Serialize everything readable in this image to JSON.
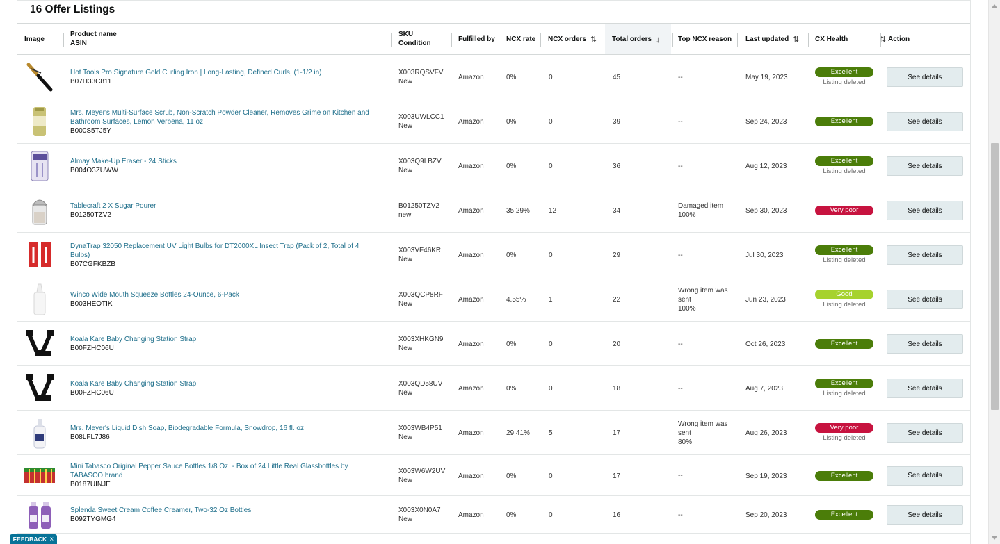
{
  "title": "16 Offer Listings",
  "headers": {
    "image": "Image",
    "product_name": "Product name",
    "asin": "ASIN",
    "sku": "SKU",
    "condition": "Condition",
    "fulfilled_by": "Fulfilled by",
    "ncx_rate": "NCX rate",
    "ncx_orders": "NCX orders",
    "total_orders": "Total orders",
    "top_ncx_reason": "Top NCX reason",
    "last_updated": "Last updated",
    "cx_health": "CX Health",
    "action": "Action"
  },
  "icons": {
    "sort_both": "sort-both-icon",
    "sort_down": "sort-down-icon",
    "close": "close-icon"
  },
  "colors": {
    "excellent": "#4b7d09",
    "good": "#a6d22e",
    "very_poor": "#c7133f",
    "link": "#1f6f8b",
    "feedback": "#077398"
  },
  "rows": [
    {
      "name": "Hot Tools Pro Signature Gold Curling Iron | Long-Lasting, Defined Curls, (1-1/2 in)",
      "asin": "B07H33C811",
      "sku": "X003RQSVFV",
      "condition": "New",
      "fulfilled": "Amazon",
      "ncx_rate": "0%",
      "ncx_orders": "0",
      "total_orders": "45",
      "reason": [
        "--"
      ],
      "updated": "May 19, 2023",
      "health": "Excellent",
      "health_level": "excellent",
      "sub": "Listing deleted",
      "action": "See details",
      "img": "curling-iron-image"
    },
    {
      "name": "Mrs. Meyer's Multi-Surface Scrub, Non-Scratch Powder Cleaner, Removes Grime on Kitchen and Bathroom Surfaces, Lemon Verbena, 11 oz",
      "asin": "B000S5TJ5Y",
      "sku": "X003UWLCC1",
      "condition": "New",
      "fulfilled": "Amazon",
      "ncx_rate": "0%",
      "ncx_orders": "0",
      "total_orders": "39",
      "reason": [
        "--"
      ],
      "updated": "Sep 24, 2023",
      "health": "Excellent",
      "health_level": "excellent",
      "sub": "",
      "action": "See details",
      "img": "scrub-can-image"
    },
    {
      "name": "Almay Make-Up Eraser - 24 Sticks",
      "asin": "B004O3ZUWW",
      "sku": "X003Q9LBZV",
      "condition": "New",
      "fulfilled": "Amazon",
      "ncx_rate": "0%",
      "ncx_orders": "0",
      "total_orders": "36",
      "reason": [
        "--"
      ],
      "updated": "Aug 12, 2023",
      "health": "Excellent",
      "health_level": "excellent",
      "sub": "Listing deleted",
      "action": "See details",
      "img": "makeup-eraser-image"
    },
    {
      "name": "Tablecraft 2 X Sugar Pourer",
      "asin": "B01250TZV2",
      "sku": "B01250TZV2",
      "condition": "new",
      "fulfilled": "Amazon",
      "ncx_rate": "35.29%",
      "ncx_orders": "12",
      "total_orders": "34",
      "reason": [
        "Damaged item",
        "100%"
      ],
      "updated": "Sep 30, 2023",
      "health": "Very poor",
      "health_level": "very_poor",
      "sub": "",
      "action": "See details",
      "img": "sugar-pourer-image"
    },
    {
      "name": "DynaTrap 32050 Replacement UV Light Bulbs for DT2000XL Insect Trap (Pack of 2, Total of 4 Bulbs)",
      "asin": "B07CGFKBZB",
      "sku": "X003VF46KR",
      "condition": "New",
      "fulfilled": "Amazon",
      "ncx_rate": "0%",
      "ncx_orders": "0",
      "total_orders": "29",
      "reason": [
        "--"
      ],
      "updated": "Jul 30, 2023",
      "health": "Excellent",
      "health_level": "excellent",
      "sub": "Listing deleted",
      "action": "See details",
      "img": "uv-bulbs-image"
    },
    {
      "name": "Winco Wide Mouth Squeeze Bottles 24-Ounce, 6-Pack",
      "asin": "B003HEOTIK",
      "sku": "X003QCP8RF",
      "condition": "New",
      "fulfilled": "Amazon",
      "ncx_rate": "4.55%",
      "ncx_orders": "1",
      "total_orders": "22",
      "reason": [
        "Wrong item was",
        "sent",
        "100%"
      ],
      "updated": "Jun 23, 2023",
      "health": "Good",
      "health_level": "good",
      "sub": "Listing deleted",
      "action": "See details",
      "img": "squeeze-bottle-image"
    },
    {
      "name": "Koala Kare Baby Changing Station Strap",
      "asin": "B00FZHC06U",
      "sku": "X003XHKGN9",
      "condition": "New",
      "fulfilled": "Amazon",
      "ncx_rate": "0%",
      "ncx_orders": "0",
      "total_orders": "20",
      "reason": [
        "--"
      ],
      "updated": "Oct 26, 2023",
      "health": "Excellent",
      "health_level": "excellent",
      "sub": "",
      "action": "See details",
      "img": "strap-image"
    },
    {
      "name": "Koala Kare Baby Changing Station Strap",
      "asin": "B00FZHC06U",
      "sku": "X003QD58UV",
      "condition": "New",
      "fulfilled": "Amazon",
      "ncx_rate": "0%",
      "ncx_orders": "0",
      "total_orders": "18",
      "reason": [
        "--"
      ],
      "updated": "Aug 7, 2023",
      "health": "Excellent",
      "health_level": "excellent",
      "sub": "Listing deleted",
      "action": "See details",
      "img": "strap-image"
    },
    {
      "name": "Mrs. Meyer's Liquid Dish Soap, Biodegradable Formula, Snowdrop, 16 fl. oz",
      "asin": "B08LFL7J86",
      "sku": "X003WB4P51",
      "condition": "New",
      "fulfilled": "Amazon",
      "ncx_rate": "29.41%",
      "ncx_orders": "5",
      "total_orders": "17",
      "reason": [
        "Wrong item was",
        "sent",
        "80%"
      ],
      "updated": "Aug 26, 2023",
      "health": "Very poor",
      "health_level": "very_poor",
      "sub": "Listing deleted",
      "action": "See details",
      "img": "dish-soap-image"
    },
    {
      "name": "Mini Tabasco Original Pepper Sauce Bottles 1/8 Oz. - Box of 24 Little Real Glassbottles by TABASCO brand",
      "asin": "B0187UINJE",
      "sku": "X003W6W2UV",
      "condition": "New",
      "fulfilled": "Amazon",
      "ncx_rate": "0%",
      "ncx_orders": "0",
      "total_orders": "17",
      "reason": [
        "--"
      ],
      "updated": "Sep 19, 2023",
      "health": "Excellent",
      "health_level": "excellent",
      "sub": "",
      "action": "See details",
      "img": "tabasco-box-image"
    },
    {
      "name": "Splenda Sweet Cream Coffee Creamer, Two-32 Oz Bottles",
      "asin": "B092TYGMG4",
      "sku": "X003X0N0A7",
      "condition": "New",
      "fulfilled": "Amazon",
      "ncx_rate": "0%",
      "ncx_orders": "0",
      "total_orders": "16",
      "reason": [
        "--"
      ],
      "updated": "Sep 20, 2023",
      "health": "Excellent",
      "health_level": "excellent",
      "sub": "",
      "action": "See details",
      "img": "creamer-image"
    }
  ],
  "feedback": {
    "label": "FEEDBACK",
    "close": "×"
  }
}
